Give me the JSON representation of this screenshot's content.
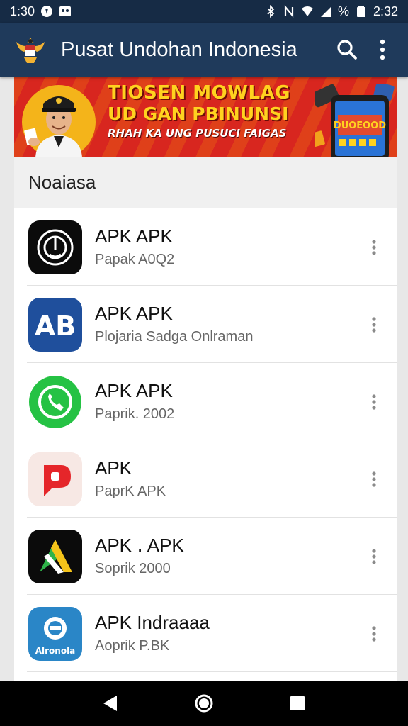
{
  "status_bar": {
    "time_left": "1:30",
    "battery_percent": "%",
    "time_right": "2:32",
    "icons": [
      "notification-icon",
      "image-notification-icon",
      "bluetooth-icon",
      "nfc-icon",
      "wifi-icon",
      "signal-icon",
      "battery-icon"
    ]
  },
  "app_bar": {
    "title": "Pusat Undohan Indonesia",
    "actions": [
      "search-icon",
      "more-vert-icon"
    ]
  },
  "banner": {
    "line1": "TIOSEN MOWLAG",
    "line2": "UD GAN PBINUNSI",
    "line3": "RHAH KA UNG PUSUCI FAIGAS",
    "phone_text": "DUOEOOD"
  },
  "section": {
    "title": "Noaiasa"
  },
  "apps": [
    {
      "title": "APK APK",
      "subtitle": "Papak A0Q2",
      "icon": "black-circle-app-icon"
    },
    {
      "title": "APK APK",
      "subtitle": "Plojaria Sadga Onlraman",
      "icon": "blue-ab-app-icon"
    },
    {
      "title": "APK APK",
      "subtitle": "Paprik. 2002",
      "icon": "green-phone-app-icon"
    },
    {
      "title": "APK",
      "subtitle": "PaprK APK",
      "icon": "red-p-app-icon"
    },
    {
      "title": "APK ․ APK",
      "subtitle": "Soprik 2000",
      "icon": "black-triangle-app-icon"
    },
    {
      "title": "APK Indraaaa",
      "subtitle": "Aoprik P.BK",
      "icon": "blue-e-app-icon",
      "icon_text": "Alronola"
    }
  ],
  "colors": {
    "status_bar": "#162b45",
    "app_bar": "#1f3a5b",
    "banner_red": "#d8261f",
    "banner_yellow": "#ffd21f"
  }
}
